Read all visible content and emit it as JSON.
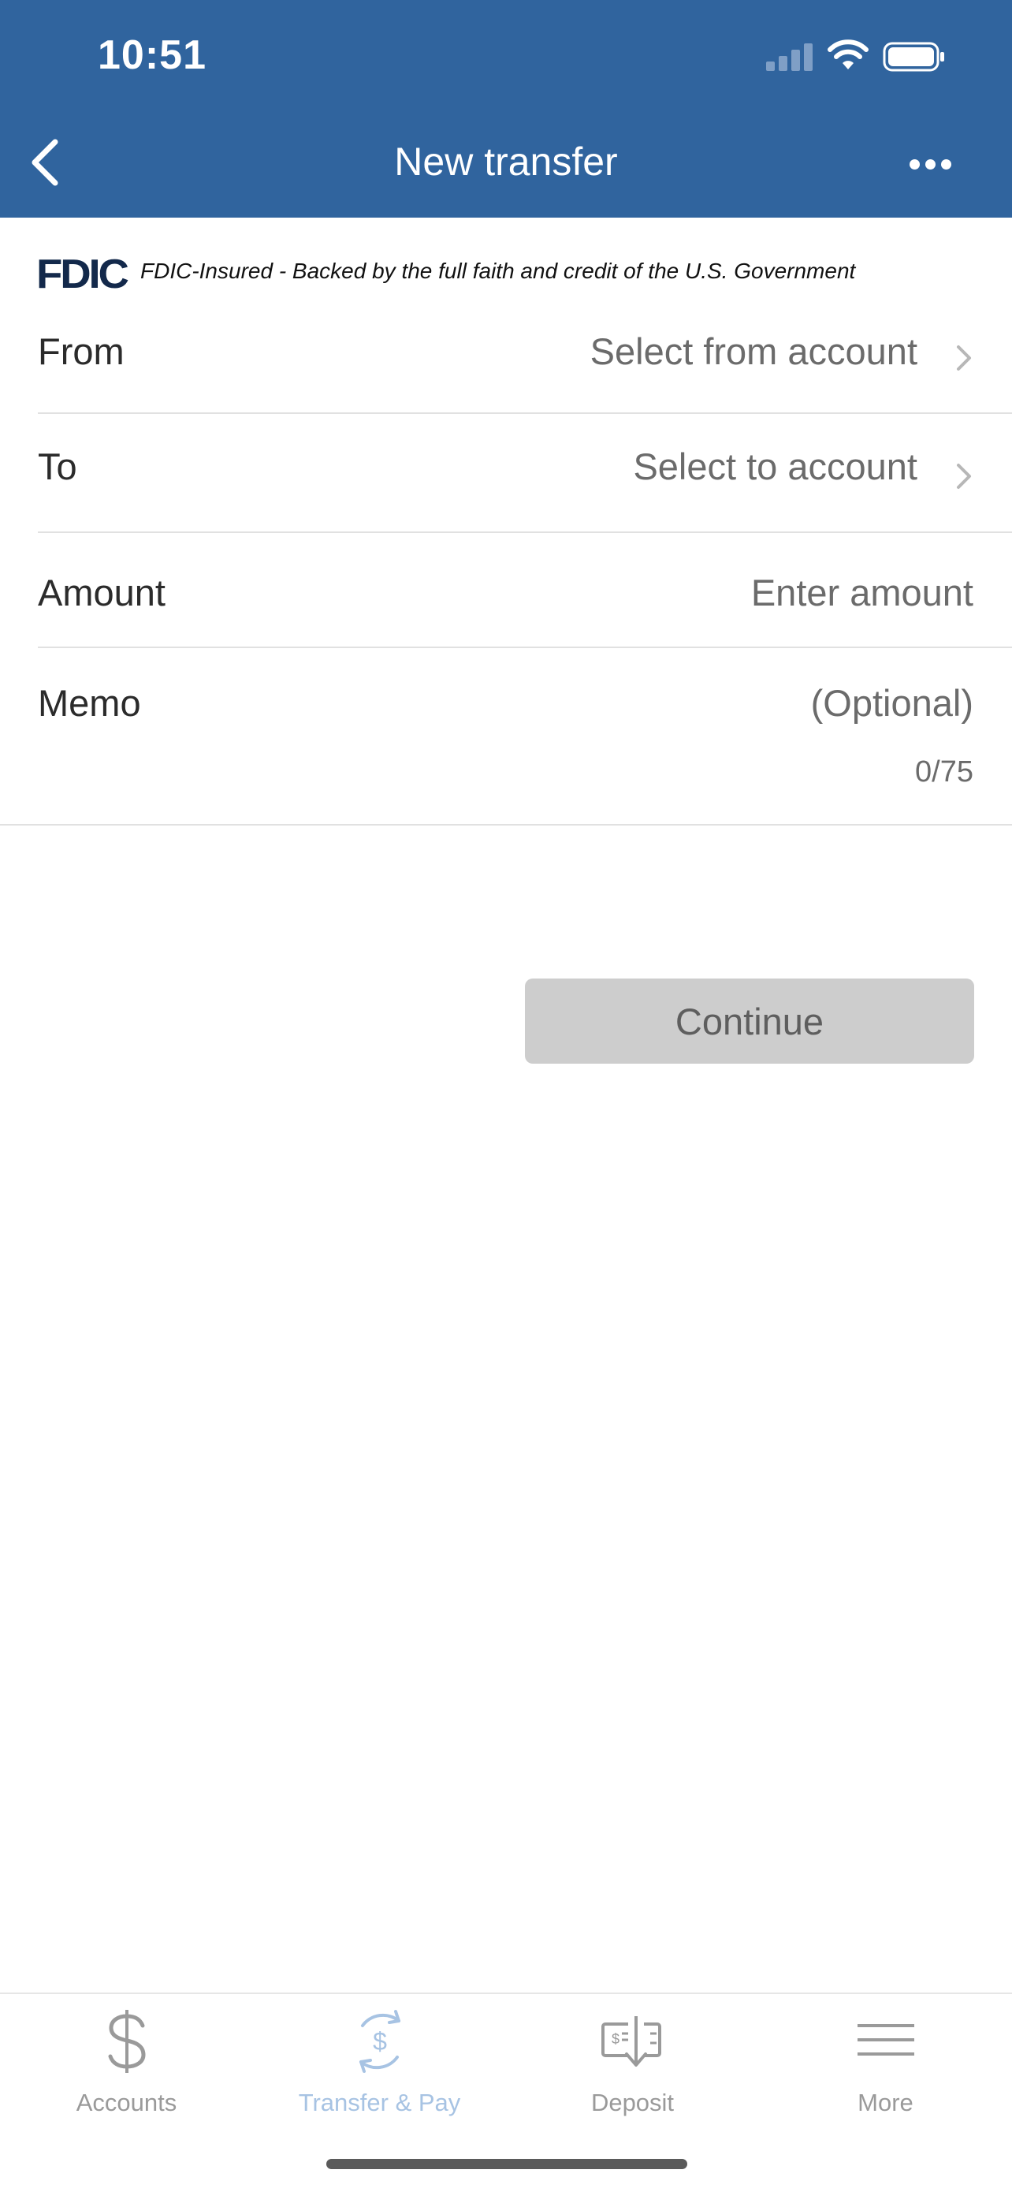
{
  "status_bar": {
    "time": "10:51"
  },
  "header": {
    "title": "New transfer"
  },
  "fdic": {
    "logo_text": "FDIC",
    "notice": "FDIC-Insured - Backed by the full faith and credit of the U.S. Government"
  },
  "form": {
    "from": {
      "label": "From",
      "value": "Select from account"
    },
    "to": {
      "label": "To",
      "value": "Select to account"
    },
    "amount": {
      "label": "Amount",
      "placeholder": "Enter amount"
    },
    "memo": {
      "label": "Memo",
      "placeholder": "(Optional)",
      "counter": "0/75"
    }
  },
  "actions": {
    "continue_label": "Continue"
  },
  "tabbar": {
    "tabs": [
      {
        "label": "Accounts",
        "icon": "dollar-icon"
      },
      {
        "label": "Transfer & Pay",
        "icon": "transfer-pay-icon",
        "active": true
      },
      {
        "label": "Deposit",
        "icon": "check-deposit-icon"
      },
      {
        "label": "More",
        "icon": "menu-icon"
      }
    ]
  },
  "colors": {
    "header_bg": "#30649e",
    "button_disabled": "#cdcdcd",
    "tab_active": "#a7c3e3",
    "fdic_navy": "#13294b"
  }
}
